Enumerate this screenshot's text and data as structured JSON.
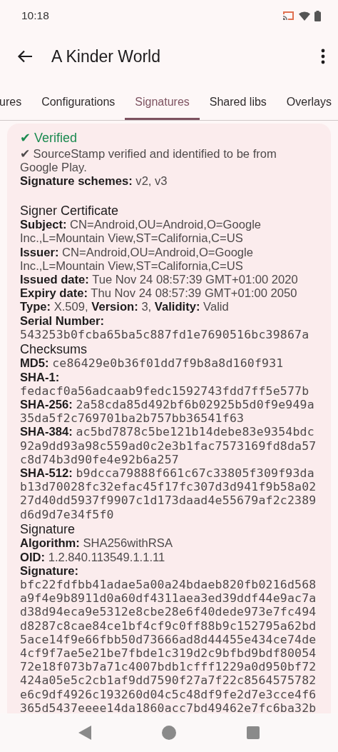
{
  "status_bar": {
    "time": "10:18"
  },
  "app_bar": {
    "title": "A Kinder World"
  },
  "tabs": [
    {
      "label": "ures",
      "selected": false
    },
    {
      "label": "Configurations",
      "selected": false
    },
    {
      "label": "Signatures",
      "selected": true
    },
    {
      "label": "Shared libs",
      "selected": false
    },
    {
      "label": "Overlays",
      "selected": false
    }
  ],
  "card": {
    "blocks": [
      {
        "kind": "status",
        "text": "✔ Verified"
      },
      {
        "kind": "text",
        "text": "✔ SourceStamp verified and identified to be from Google Play."
      },
      {
        "kind": "field",
        "label": "Signature schemes:",
        "value": "v2, v3"
      },
      {
        "kind": "spacer"
      },
      {
        "kind": "heading",
        "text": "Signer Certificate"
      },
      {
        "kind": "field",
        "label": "Subject:",
        "value": "CN=Android,OU=Android,O=Google Inc.,L=Mountain View,ST=California,C=US"
      },
      {
        "kind": "field",
        "label": "Issuer:",
        "value": "CN=Android,OU=Android,O=Google Inc.,L=Mountain View,ST=California,C=US"
      },
      {
        "kind": "field",
        "label": "Issued date:",
        "value": "Tue Nov 24 08:57:39 GMT+01:00 2020"
      },
      {
        "kind": "field",
        "label": "Expiry date:",
        "value": "Thu Nov 24 08:57:39 GMT+01:00 2050"
      },
      {
        "kind": "pairs",
        "pairs": [
          {
            "label": "Type:",
            "value": "X.509,"
          },
          {
            "label": "Version:",
            "value": "3,"
          },
          {
            "label": "Validity:",
            "value": "Valid"
          }
        ]
      },
      {
        "kind": "hash_below",
        "label": "Serial Number:",
        "value": "543253b0fcba65ba5c887fd1e7690516bc39867a"
      },
      {
        "kind": "heading",
        "text": "Checksums"
      },
      {
        "kind": "hash",
        "label": "MD5:",
        "value": "ce86429e0b36f01dd7f9b8a8d160f931"
      },
      {
        "kind": "hash_below",
        "label": "SHA-1:",
        "value": "fedacf0a56adcaab9fedc1592743fdd7ff5e577b"
      },
      {
        "kind": "hash",
        "label": "SHA-256:",
        "value": "2a58cda85d492bf6b02925b5d0f9e949a35da5f2c769701ba2b757bb36541f63"
      },
      {
        "kind": "hash",
        "label": "SHA-384:",
        "value": "ac5bd7878c5be121b14debe83e9354bdc92a9dd93a98c559ad0c2e3b1fac7573169fd8da57c8d74b3d90fe4e92b6a257"
      },
      {
        "kind": "hash",
        "label": "SHA-512:",
        "value": "b9dcca79888f661c67c33805f309f93dab13d70028fc32efac45f17fc307d3d941f9b58a0227d40dd5937f9907c1d173daad4e55679af2c2389d6d9d7e34f5f0"
      },
      {
        "kind": "heading",
        "text": "Signature"
      },
      {
        "kind": "field",
        "label": "Algorithm:",
        "value": "SHA256withRSA"
      },
      {
        "kind": "field",
        "label": "OID:",
        "value": "1.2.840.113549.1.1.11"
      },
      {
        "kind": "hash_below",
        "label": "Signature:",
        "value": "bfc22fdfbb41adae5a00a24bdaeb820fb0216d568a9f4e9b8911d0a60df4311aea3ed39ddf44e9ac7ad38d94eca9e5312e8cbe28e6f40dede973e7fc494d8287c8cae84ce1bf4cf9c0ff88b9c152795a62bd5ace14f9e66fbb50d73666ad8d44455e434ce74de4cf9f7ae5e21be7fbde1c319d2c9bfbd9bdf8005472e18f073b7a71c4007bdb1cfff1229a0d950bf72424a05e5c2cb1af9dd7590f27a7f22c8564575782e6c9df4926c193260d04c5c48df9fe2d7e3cce4f6365d5437eeee14da1860acc7bd49462e7fc6ba32b"
      }
    ]
  }
}
